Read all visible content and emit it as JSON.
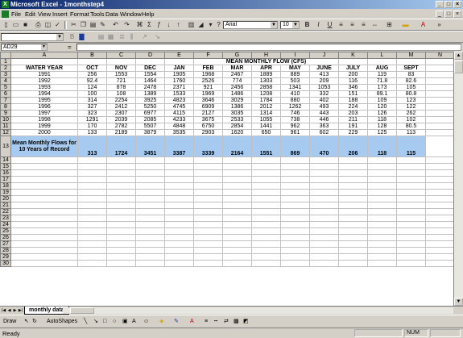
{
  "window": {
    "title": "Microsoft Excel - 1monthstep4",
    "app_icon": "excel-icon"
  },
  "menu": [
    "File",
    "Edit",
    "View",
    "Insert",
    "Format",
    "Tools",
    "Data",
    "Window",
    "Help"
  ],
  "toolbar": {
    "font_name": "Arial",
    "font_size": "10"
  },
  "formula_bar": {
    "name_box": "AD29",
    "fx": "=",
    "content": ""
  },
  "columns": [
    "A",
    "B",
    "C",
    "D",
    "E",
    "F",
    "G",
    "H",
    "I",
    "J",
    "K",
    "L",
    "M",
    "N"
  ],
  "sheet": {
    "title": "MEAN MONTHLY FLOW (CFS)",
    "headers": [
      "WATER YEAR",
      "OCT",
      "NOV",
      "DEC",
      "JAN",
      "FEB",
      "MAR",
      "APR",
      "MAY",
      "JUNE",
      "JULY",
      "AUG",
      "SEPT"
    ],
    "rows": [
      [
        "1991",
        "256",
        "1553",
        "1554",
        "1905",
        "1968",
        "2467",
        "1889",
        "889",
        "413",
        "200",
        "119",
        "83"
      ],
      [
        "1992",
        "92.4",
        "721",
        "1464",
        "1760",
        "2526",
        "774",
        "1303",
        "503",
        "209",
        "116",
        "71.8",
        "82.6"
      ],
      [
        "1993",
        "124",
        "878",
        "2478",
        "2371",
        "921",
        "2456",
        "2858",
        "1341",
        "1053",
        "346",
        "173",
        "105"
      ],
      [
        "1994",
        "100",
        "108",
        "1389",
        "1533",
        "1969",
        "1486",
        "1208",
        "410",
        "332",
        "151",
        "89.1",
        "80.8"
      ],
      [
        "1995",
        "314",
        "2254",
        "3925",
        "4823",
        "3646",
        "3029",
        "1784",
        "880",
        "402",
        "188",
        "109",
        "123"
      ],
      [
        "1996",
        "327",
        "2412",
        "5250",
        "4745",
        "6909",
        "1386",
        "2012",
        "1262",
        "493",
        "224",
        "120",
        "122"
      ],
      [
        "1997",
        "323",
        "2307",
        "6977",
        "4115",
        "2127",
        "3035",
        "1314",
        "746",
        "443",
        "203",
        "126",
        "262"
      ],
      [
        "1998",
        "1291",
        "2039",
        "2085",
        "4233",
        "3675",
        "2533",
        "1055",
        "738",
        "446",
        "211",
        "118",
        "102"
      ],
      [
        "1999",
        "170",
        "2782",
        "5507",
        "4848",
        "6750",
        "2854",
        "1441",
        "962",
        "363",
        "191",
        "128",
        "80.5"
      ],
      [
        "2000",
        "133",
        "2189",
        "3879",
        "3535",
        "2903",
        "1620",
        "650",
        "961",
        "602",
        "229",
        "125",
        "113"
      ]
    ],
    "mean_label": "Mean Monthly Flows for 10 Years of Record",
    "mean_values": [
      "313",
      "1724",
      "3451",
      "3387",
      "3339",
      "2164",
      "1551",
      "869",
      "470",
      "206",
      "118",
      "115"
    ],
    "tab_name": "monthly data",
    "extra_row_numbers": [
      "14",
      "15",
      "16",
      "17",
      "18",
      "19",
      "20",
      "21",
      "22",
      "23",
      "24",
      "25",
      "26",
      "27",
      "28",
      "29",
      "30"
    ]
  },
  "draw_toolbar": {
    "draw_label": "Draw",
    "autoshapes_label": "AutoShapes"
  },
  "status": {
    "text": "Ready",
    "num": "NUM"
  },
  "colors": {
    "title_bar": "#0a246a",
    "mean_row": "#a6caf0",
    "chrome": "#d4d0c8"
  }
}
